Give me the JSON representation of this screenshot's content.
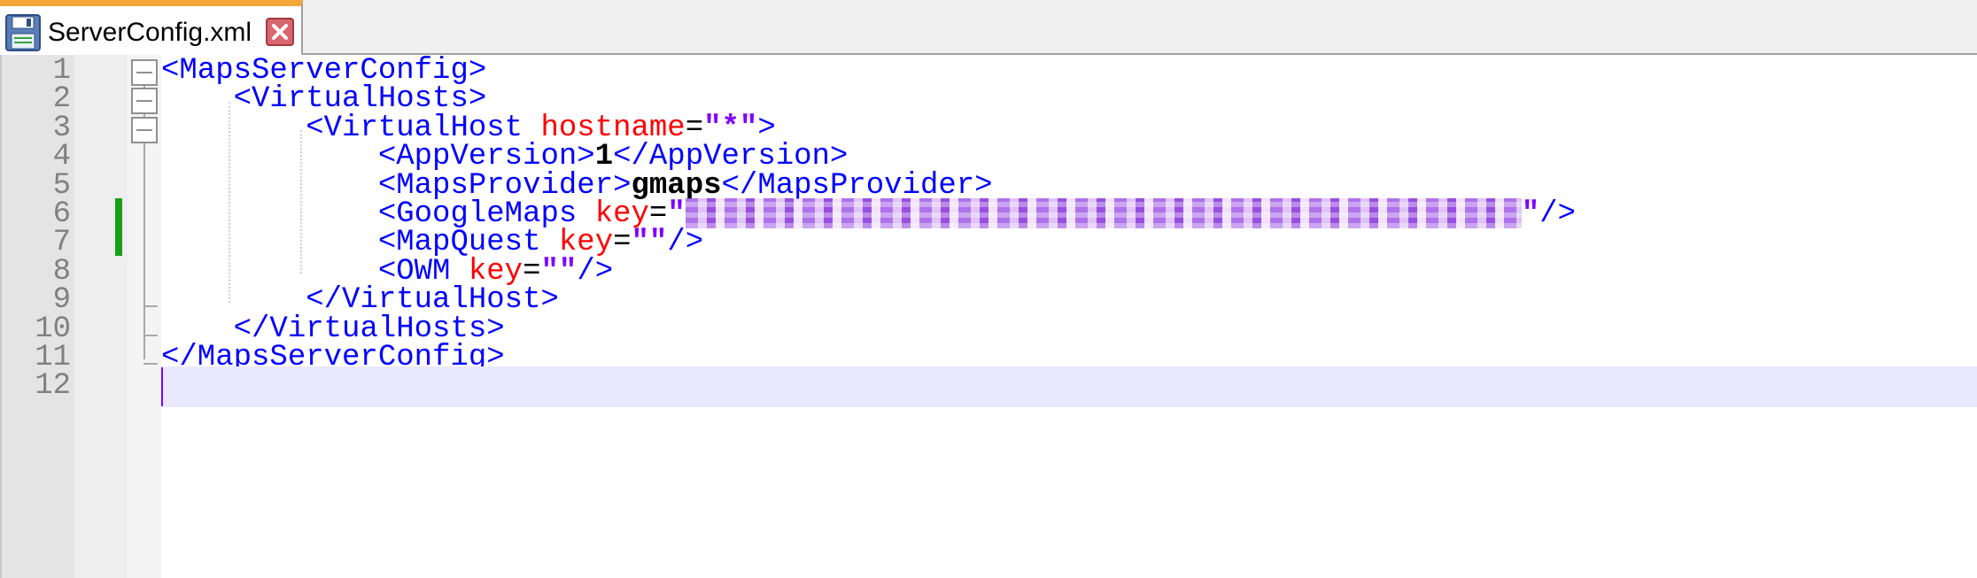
{
  "tab": {
    "title": "ServerConfig.xml",
    "save_icon": "save-floppy-icon",
    "close_icon": "close-icon"
  },
  "line_numbers": [
    "1",
    "2",
    "3",
    "4",
    "5",
    "6",
    "7",
    "8",
    "9",
    "10",
    "11",
    "12"
  ],
  "lines": [
    {
      "parts": [
        {
          "c": "tag",
          "t": "<MapsServerConfig>"
        }
      ]
    },
    {
      "parts": [
        {
          "c": "punct",
          "t": "    "
        },
        {
          "c": "tag",
          "t": "<VirtualHosts>"
        }
      ]
    },
    {
      "parts": [
        {
          "c": "punct",
          "t": "        "
        },
        {
          "c": "tag",
          "t": "<VirtualHost "
        },
        {
          "c": "attr",
          "t": "hostname"
        },
        {
          "c": "punct",
          "t": "="
        },
        {
          "c": "str",
          "t": "\"*\""
        },
        {
          "c": "tag",
          "t": ">"
        }
      ]
    },
    {
      "parts": [
        {
          "c": "punct",
          "t": "            "
        },
        {
          "c": "tag",
          "t": "<AppVersion>"
        },
        {
          "c": "text",
          "t": "1"
        },
        {
          "c": "tag",
          "t": "</AppVersion>"
        }
      ]
    },
    {
      "parts": [
        {
          "c": "punct",
          "t": "            "
        },
        {
          "c": "tag",
          "t": "<MapsProvider>"
        },
        {
          "c": "text",
          "t": "gmaps"
        },
        {
          "c": "tag",
          "t": "</MapsProvider>"
        }
      ]
    },
    {
      "parts": [
        {
          "c": "punct",
          "t": "            "
        },
        {
          "c": "tag",
          "t": "<GoogleMaps "
        },
        {
          "c": "attr",
          "t": "key"
        },
        {
          "c": "punct",
          "t": "="
        },
        {
          "c": "str",
          "t": "\""
        },
        {
          "c": "redacted",
          "t": ""
        },
        {
          "c": "str",
          "t": "\""
        },
        {
          "c": "tag",
          "t": "/>"
        }
      ]
    },
    {
      "parts": [
        {
          "c": "punct",
          "t": "            "
        },
        {
          "c": "tag",
          "t": "<MapQuest "
        },
        {
          "c": "attr",
          "t": "key"
        },
        {
          "c": "punct",
          "t": "="
        },
        {
          "c": "str",
          "t": "\"\""
        },
        {
          "c": "tag",
          "t": "/>"
        }
      ]
    },
    {
      "parts": [
        {
          "c": "punct",
          "t": "            "
        },
        {
          "c": "tag",
          "t": "<OWM "
        },
        {
          "c": "attr",
          "t": "key"
        },
        {
          "c": "punct",
          "t": "="
        },
        {
          "c": "str",
          "t": "\"\""
        },
        {
          "c": "tag",
          "t": "/>"
        }
      ]
    },
    {
      "parts": [
        {
          "c": "punct",
          "t": "        "
        },
        {
          "c": "tag",
          "t": "</VirtualHost>"
        }
      ]
    },
    {
      "parts": [
        {
          "c": "punct",
          "t": "    "
        },
        {
          "c": "tag",
          "t": "</VirtualHosts>"
        }
      ]
    },
    {
      "parts": [
        {
          "c": "tag",
          "t": "</MapsServerConfig>"
        }
      ]
    },
    {
      "parts": []
    }
  ],
  "colors": {
    "tag": "#0000ff",
    "attribute": "#ff0000",
    "string": "#8000ff",
    "text": "#000000",
    "tab_accent": "#f4a63a",
    "change_marker": "#15a015",
    "current_line": "#e8e8ff"
  }
}
